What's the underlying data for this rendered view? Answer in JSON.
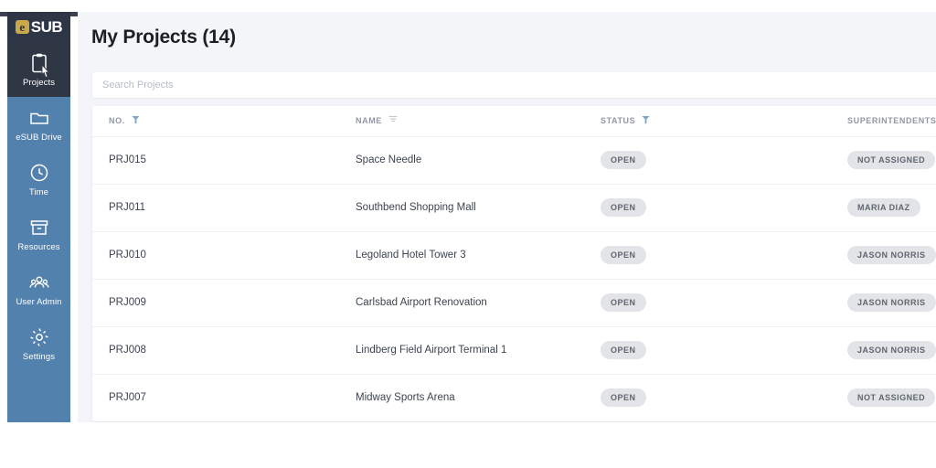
{
  "app": {
    "logo_mark": "e",
    "logo_text": "SUB"
  },
  "sidebar": {
    "items": [
      {
        "label": "Projects",
        "icon": "clipboard-icon",
        "active": true
      },
      {
        "label": "eSUB Drive",
        "icon": "folder-icon",
        "active": false
      },
      {
        "label": "Time",
        "icon": "clock-icon",
        "active": false
      },
      {
        "label": "Resources",
        "icon": "box-icon",
        "active": false
      },
      {
        "label": "User Admin",
        "icon": "users-icon",
        "active": false
      },
      {
        "label": "Settings",
        "icon": "gear-icon",
        "active": false
      }
    ]
  },
  "main": {
    "page_title": "My Projects (14)",
    "search": {
      "placeholder": "Search Projects",
      "value": ""
    },
    "table": {
      "columns": [
        {
          "label": "NO.",
          "filter_icon": "filter-icon",
          "filter_active": true
        },
        {
          "label": "NAME",
          "filter_icon": "filter-lines-icon",
          "filter_active": false
        },
        {
          "label": "STATUS",
          "filter_icon": "filter-icon",
          "filter_active": true
        },
        {
          "label": "SUPERINTENDENTS",
          "filter_icon": "",
          "filter_active": false
        }
      ],
      "rows": [
        {
          "no": "PRJ015",
          "name": "Space Needle",
          "status": "OPEN",
          "superintendent": "NOT ASSIGNED"
        },
        {
          "no": "PRJ011",
          "name": "Southbend Shopping Mall",
          "status": "OPEN",
          "superintendent": "MARIA DIAZ"
        },
        {
          "no": "PRJ010",
          "name": "Legoland Hotel Tower 3",
          "status": "OPEN",
          "superintendent": "JASON NORRIS"
        },
        {
          "no": "PRJ009",
          "name": "Carlsbad Airport Renovation",
          "status": "OPEN",
          "superintendent": "JASON NORRIS"
        },
        {
          "no": "PRJ008",
          "name": "Lindberg Field Airport Terminal 1",
          "status": "OPEN",
          "superintendent": "JASON NORRIS"
        },
        {
          "no": "PRJ007",
          "name": "Midway Sports Arena",
          "status": "OPEN",
          "superintendent": "NOT ASSIGNED"
        }
      ]
    }
  },
  "colors": {
    "sidebar_bg": "#5381ad",
    "sidebar_active_bg": "#2f3745",
    "logo_bg": "#2e3646",
    "logo_mark_bg": "#c9a84c",
    "page_bg": "#f3f5f9",
    "card_bg": "#ffffff",
    "filter_active": "#7fa6c9",
    "filter_inactive": "#c3c8d0",
    "pill_bg": "#e2e4e8",
    "pill_text": "#5f6670"
  }
}
